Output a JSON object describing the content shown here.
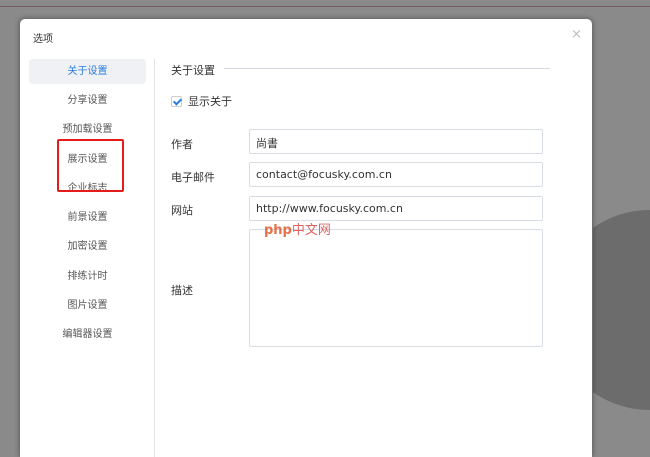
{
  "dialog": {
    "title": "选项",
    "close": "×"
  },
  "sidebar": {
    "items": [
      {
        "label": "关于设置",
        "active": true
      },
      {
        "label": "分享设置"
      },
      {
        "label": "预加载设置"
      },
      {
        "label": "展示设置"
      },
      {
        "label": "企业标志"
      },
      {
        "label": "前景设置"
      },
      {
        "label": "加密设置"
      },
      {
        "label": "排练计时"
      },
      {
        "label": "图片设置"
      },
      {
        "label": "编辑器设置"
      }
    ]
  },
  "main": {
    "section_title": "关于设置",
    "show_about": {
      "label": "显示关于",
      "checked": true
    },
    "author": {
      "label": "作者",
      "value": "尚書"
    },
    "email": {
      "label": "电子邮件",
      "value": "contact@focusky.com.cn"
    },
    "website": {
      "label": "网站",
      "value": "http://www.focusky.com.cn"
    },
    "description": {
      "label": "描述",
      "value": ""
    }
  },
  "watermark": {
    "text": "php中文网"
  },
  "colors": {
    "accent": "#2a7de1",
    "highlight": "#e41c1c"
  }
}
